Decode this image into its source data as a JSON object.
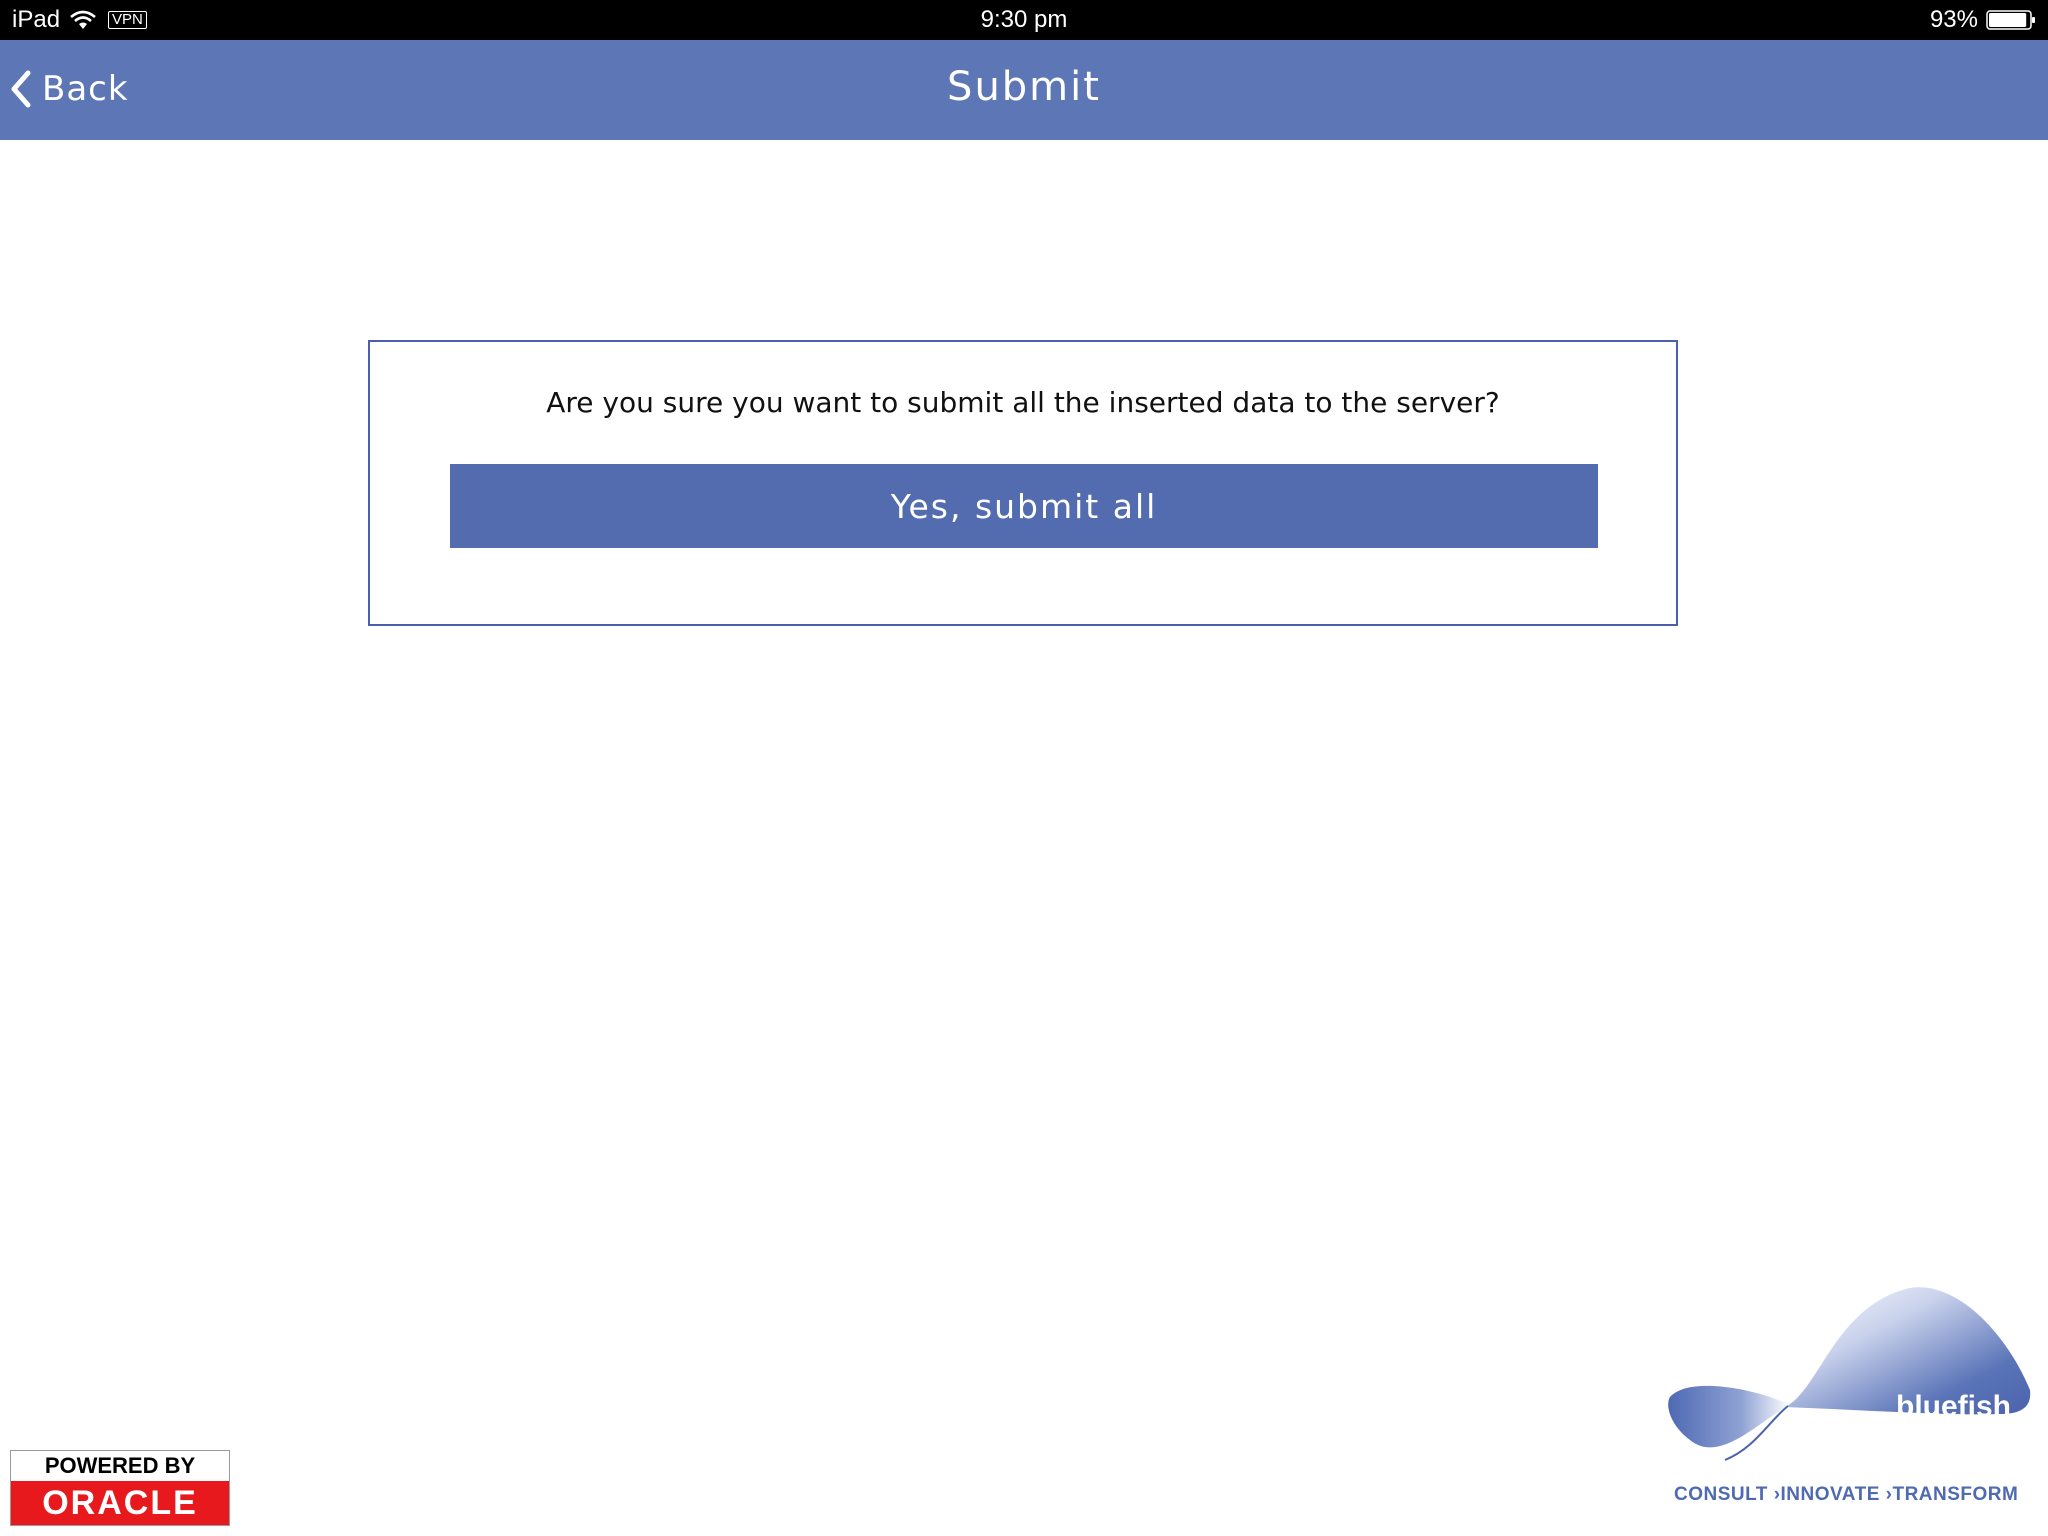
{
  "status_bar": {
    "device": "iPad",
    "vpn": "VPN",
    "time": "9:30 pm",
    "battery": "93%",
    "battery_level": 0.93
  },
  "nav": {
    "back_label": "Back",
    "title": "Submit"
  },
  "dialog": {
    "message": "Are you sure you want to submit all the inserted data to the server?",
    "confirm_label": "Yes, submit all"
  },
  "oracle_badge": {
    "top": "POWERED BY",
    "bottom": "ORACLE"
  },
  "bluefish_logo": {
    "name": "bluefish",
    "tagline": "CONSULT ›INNOVATE ›TRANSFORM"
  },
  "colors": {
    "nav_bar": "#5d76b6",
    "button": "#526caf",
    "box_border": "#4a5fb0",
    "oracle_red": "#e8191c"
  }
}
